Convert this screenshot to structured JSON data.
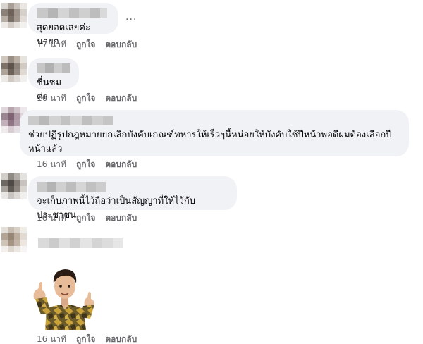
{
  "comments": [
    {
      "text": "สุดยอดเลยค่ะนายก",
      "time": "17 นาที",
      "like": "ถูกใจ",
      "reply": "ตอบกลับ",
      "more": "···"
    },
    {
      "text": "ชื่นชมค่ะ",
      "time": "16 นาที",
      "like": "ถูกใจ",
      "reply": "ตอบกลับ"
    },
    {
      "text": "ช่วยปฏิรูปกฎหมายยกเลิกบังคับเกณฑ์ทหารให้เร็วๆนี้หน่อยให้บังคับใช้ปีหน้าพอดีผมต้องเลือกปีหน้าแล้ว",
      "time": "16 นาที",
      "like": "ถูกใจ",
      "reply": "ตอบกลับ"
    },
    {
      "text": "จะเก็บภาพนี้ไว้ถือว่าเป็นสัญญาที่ให้ไว้กับประชาชน",
      "time": "16 นาที",
      "like": "ถูกใจ",
      "reply": "ตอบกลับ"
    },
    {
      "text": "",
      "time": "16 นาที",
      "like": "ถูกใจ",
      "reply": "ตอบกลับ",
      "sticker": "thumbs-up-avatar-sticker"
    }
  ],
  "colors": {
    "bubble": "#f0f2f5",
    "meta": "#65676b",
    "text": "#050505"
  }
}
